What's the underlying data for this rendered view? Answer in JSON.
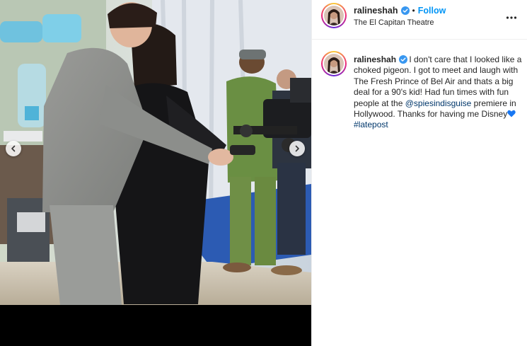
{
  "post": {
    "username": "ralineshah",
    "follow_label": "Follow",
    "separator": "•",
    "location": "The El Capitan Theatre",
    "caption": {
      "text_1": "I don't care that I looked like a choked pigeon. I got to meet and laugh with The Fresh Prince of Bel Air and thats a big deal for a 90's kid! Had fun times with fun people at the",
      "mention": "@spiesindisguise",
      "text_2": "premiere in Hollywood. Thanks for having me Disney",
      "hashtag": "#latepost"
    }
  },
  "icons": {
    "verified": "verified-badge-icon",
    "more": "more-options-icon",
    "prev": "chevron-left-icon",
    "next": "chevron-right-icon",
    "heart": "blue-heart-emoji"
  },
  "colors": {
    "link": "#0095f6",
    "mention": "#00376b",
    "verified": "#3897f0",
    "text": "#262626",
    "heart": "#1877f2"
  }
}
